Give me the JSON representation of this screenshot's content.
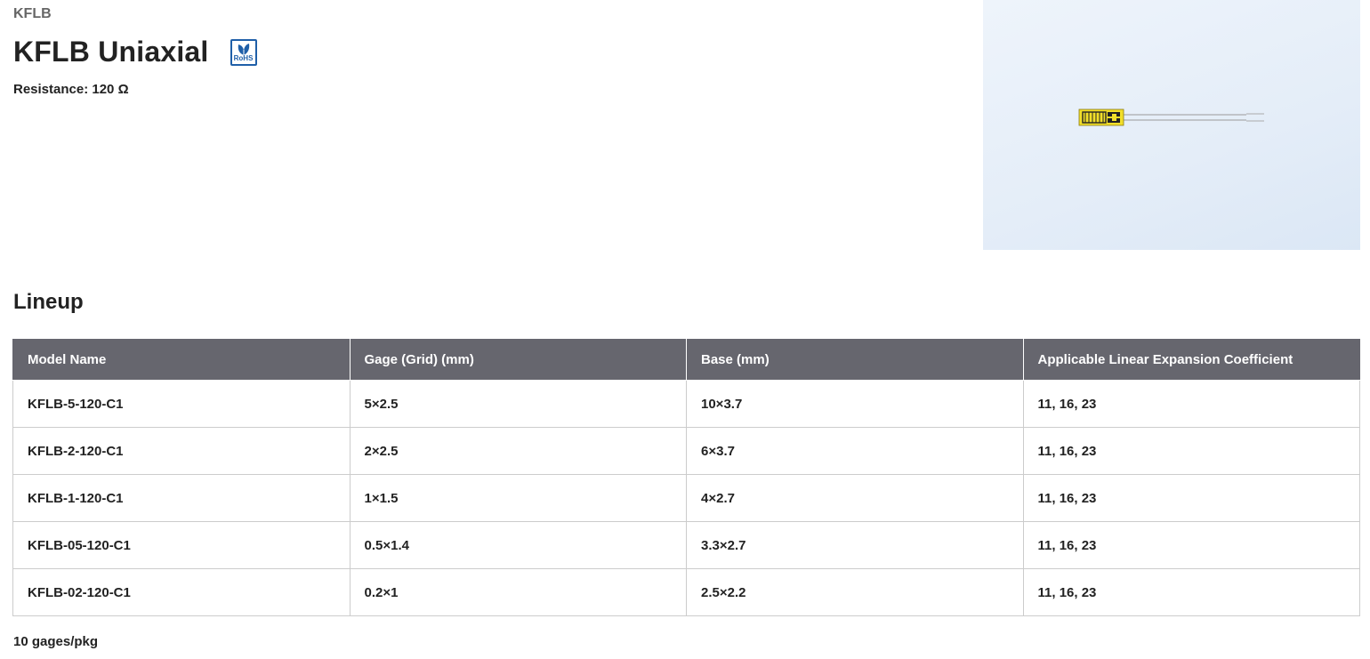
{
  "breadcrumb": "KFLB",
  "product": {
    "title": "KFLB Uniaxial",
    "rohs_label": "RoHS",
    "resistance": "Resistance: 120 Ω"
  },
  "lineup": {
    "heading": "Lineup",
    "columns": [
      "Model Name",
      "Gage (Grid) (mm)",
      "Base (mm)",
      "Applicable Linear Expansion Coefficient"
    ],
    "rows": [
      [
        "KFLB-5-120-C1",
        "5×2.5",
        "10×3.7",
        "11, 16, 23"
      ],
      [
        "KFLB-2-120-C1",
        "2×2.5",
        "6×3.7",
        "11, 16, 23"
      ],
      [
        "KFLB-1-120-C1",
        "1×1.5",
        "4×2.7",
        "11, 16, 23"
      ],
      [
        "KFLB-05-120-C1",
        "0.5×1.4",
        "3.3×2.7",
        "11, 16, 23"
      ],
      [
        "KFLB-02-120-C1",
        "0.2×1",
        "2.5×2.2",
        "11, 16, 23"
      ]
    ],
    "footnote": "10 gages/pkg"
  },
  "colors": {
    "header_bg": "#66666e",
    "rohs_blue": "#1f5fa8",
    "photo_bg": "#e4edf8",
    "gage_yellow": "#f2df2a"
  },
  "icons": {
    "rohs": "rohs-leaf-icon"
  }
}
